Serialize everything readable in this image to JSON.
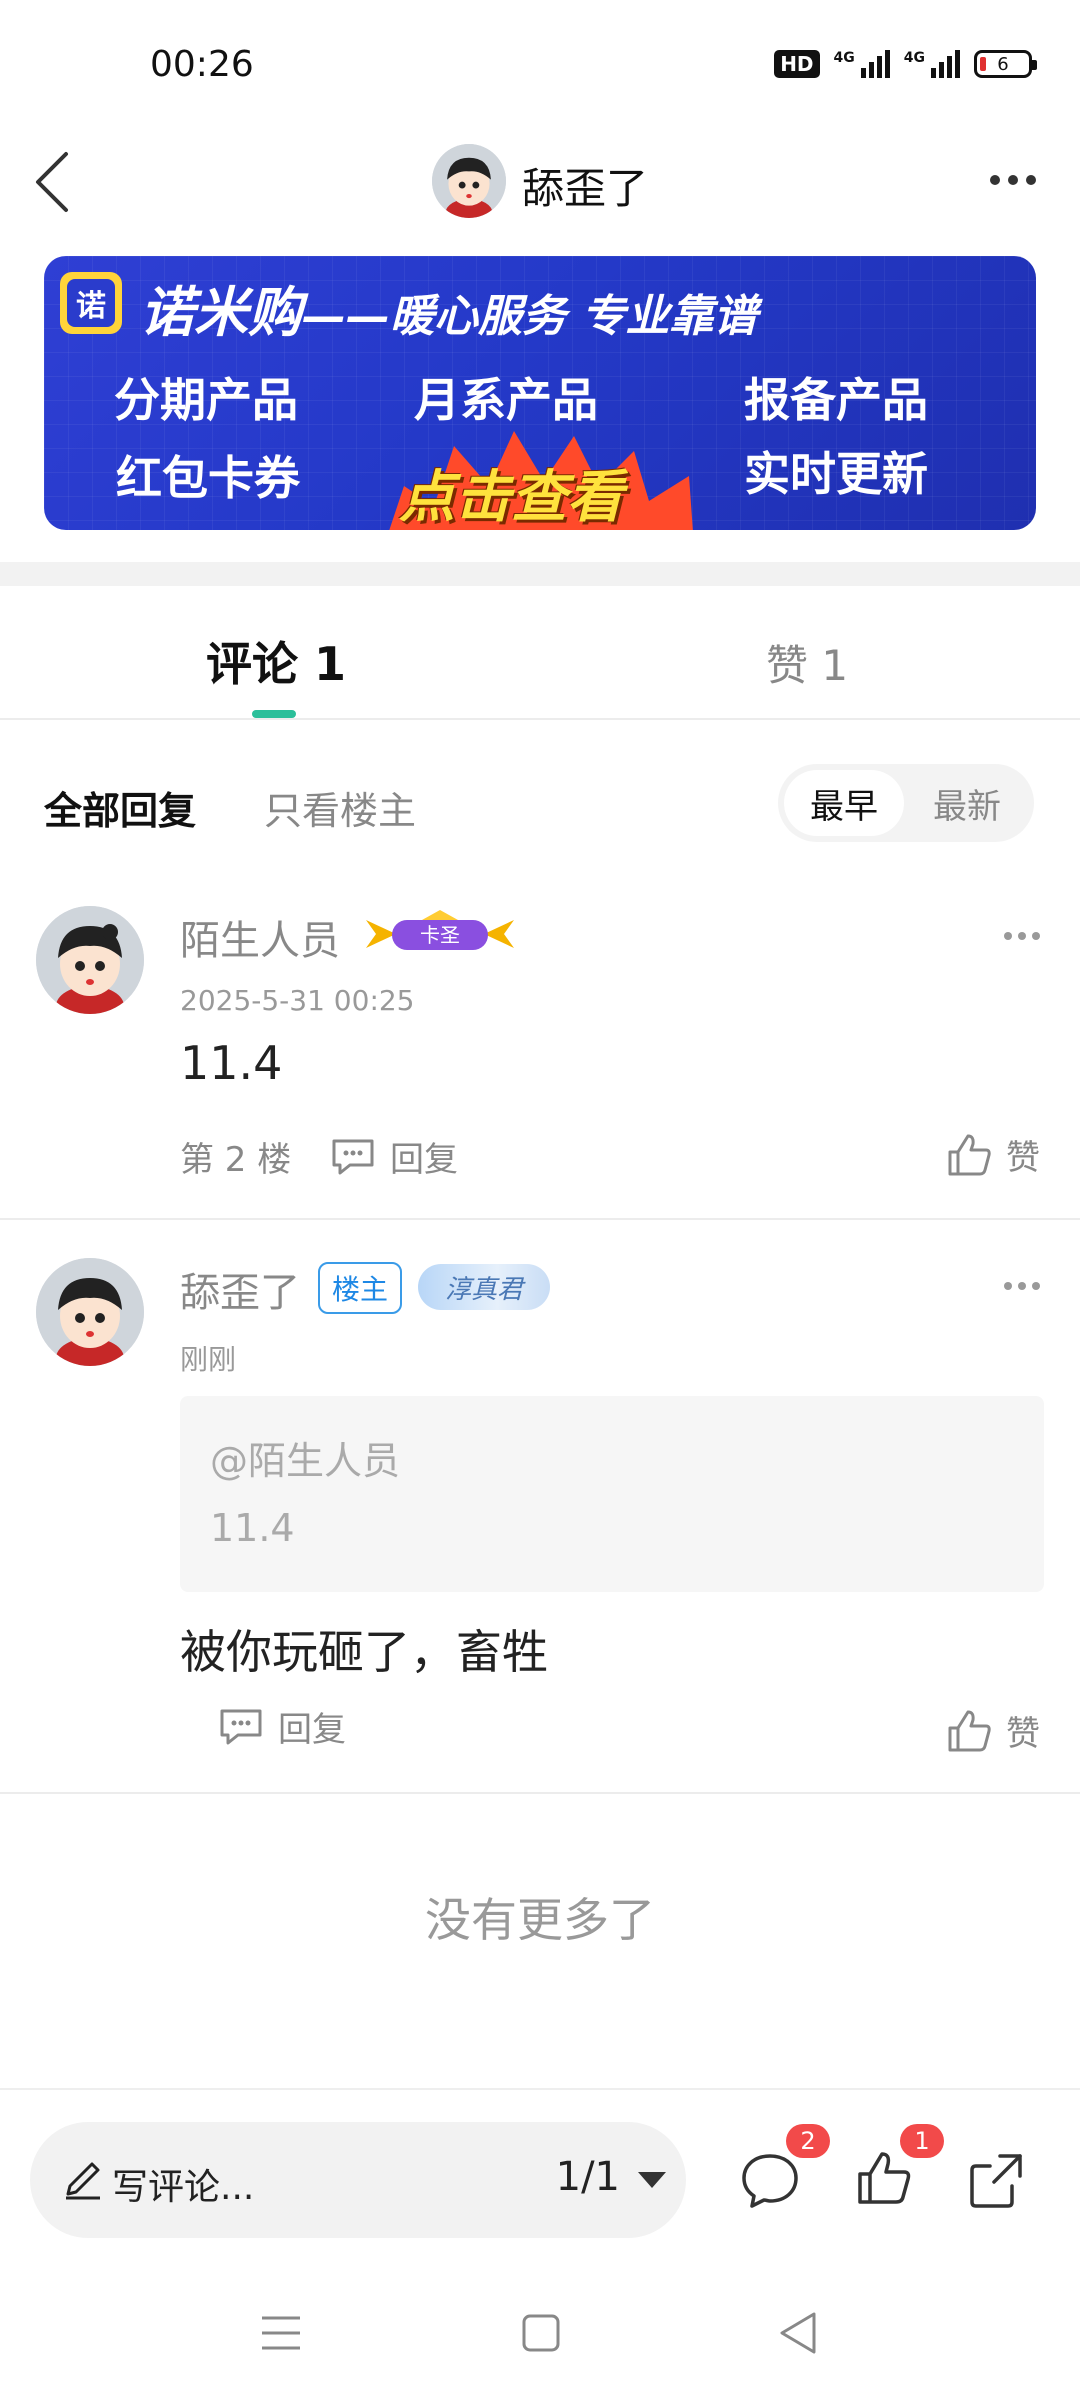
{
  "status_bar": {
    "time": "00:26",
    "hd": "HD",
    "signal1": "4G",
    "signal2": "4G",
    "battery": "6"
  },
  "header": {
    "title": "舔歪了"
  },
  "banner": {
    "logo_char": "诺",
    "brand": "诺米购",
    "tagline": "——暖心服务 专业靠谱",
    "items": [
      "分期产品",
      "月系产品",
      "报备产品",
      "红包卡券",
      "实时更新"
    ],
    "cta": "点击查看",
    "bg_color": "#2439c8"
  },
  "tabs": {
    "comments": "评论 1",
    "likes": "赞 1",
    "accent_color": "#2bbf9a"
  },
  "filter": {
    "all": "全部回复",
    "op_only": "只看楼主",
    "sort_earliest": "最早",
    "sort_latest": "最新"
  },
  "comments": [
    {
      "username": "陌生人员",
      "badge": "卡圣",
      "time": "2025-5-31 00:25",
      "text": "11.4",
      "floor": "第 2 楼",
      "reply_label": "回复",
      "like_label": "赞"
    },
    {
      "username": "舔歪了",
      "op_badge": "楼主",
      "rank_badge": "淳真君",
      "time": "刚刚",
      "quote_user": "@陌生人员",
      "quote_text": "11.4",
      "text": "被你玩砸了，畜牲",
      "reply_label": "回复",
      "like_label": "赞"
    }
  ],
  "footer": {
    "no_more": "没有更多了"
  },
  "bottom_bar": {
    "placeholder": "写评论...",
    "page": "1/1",
    "comment_count": "2",
    "like_count": "1",
    "badge_color": "#f24a4a"
  },
  "icons": [
    "back-icon",
    "more-icon",
    "comment-icon",
    "like-icon",
    "share-icon",
    "pencil-icon",
    "reply-icon",
    "menu-icon",
    "home-icon",
    "nav-back-icon"
  ]
}
